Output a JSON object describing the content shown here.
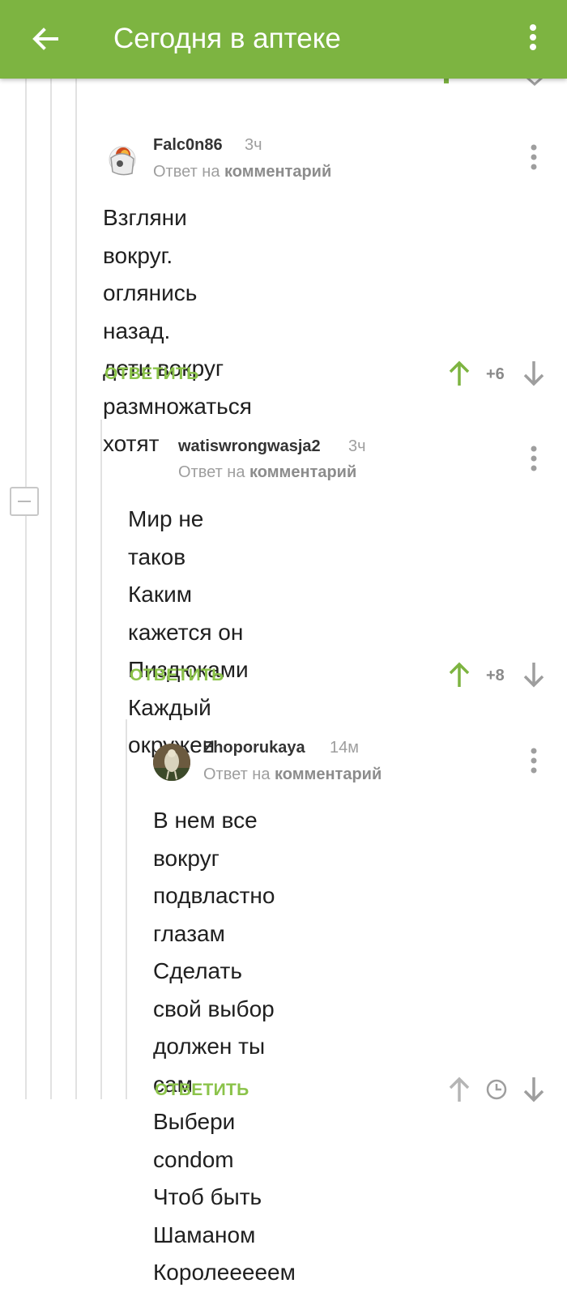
{
  "appbar": {
    "title": "Сегодня в аптеке",
    "background": "#7db441"
  },
  "reply_to_prefix": "Ответ на",
  "reply_to_link": "комментарий",
  "reply_label": "ОТВЕТИТЬ",
  "comments": [
    {
      "author": "Falc0n86",
      "time": "3ч",
      "text": "Взгляни вокруг.\nоглянись назад.\nдети вокруг\nразмножаться хотят",
      "rating": "+6"
    },
    {
      "author": "watiswrongwasja2",
      "time": "3ч",
      "text": "Мир не таков\nКаким кажется он\nПиздюками\nКаждый окружен",
      "rating": "+8"
    },
    {
      "author": "Zhoporukaya",
      "time": "14м",
      "text": "В нем все вокруг подвластно\nглазам\nСделать свой выбор должен ты\nсам\nВыбери condom\nЧтоб быть Шаманом\nКоролееееем"
    }
  ],
  "icons": {
    "back": "arrow-left-icon",
    "menu": "more-vertical-icon",
    "upvote": "arrow-up-icon",
    "downvote": "arrow-down-icon",
    "pending": "clock-icon",
    "collapse": "minus-square-icon"
  },
  "colors": {
    "accent": "#7db441",
    "reply": "#8bc34a",
    "muted": "#9e9e9e"
  }
}
